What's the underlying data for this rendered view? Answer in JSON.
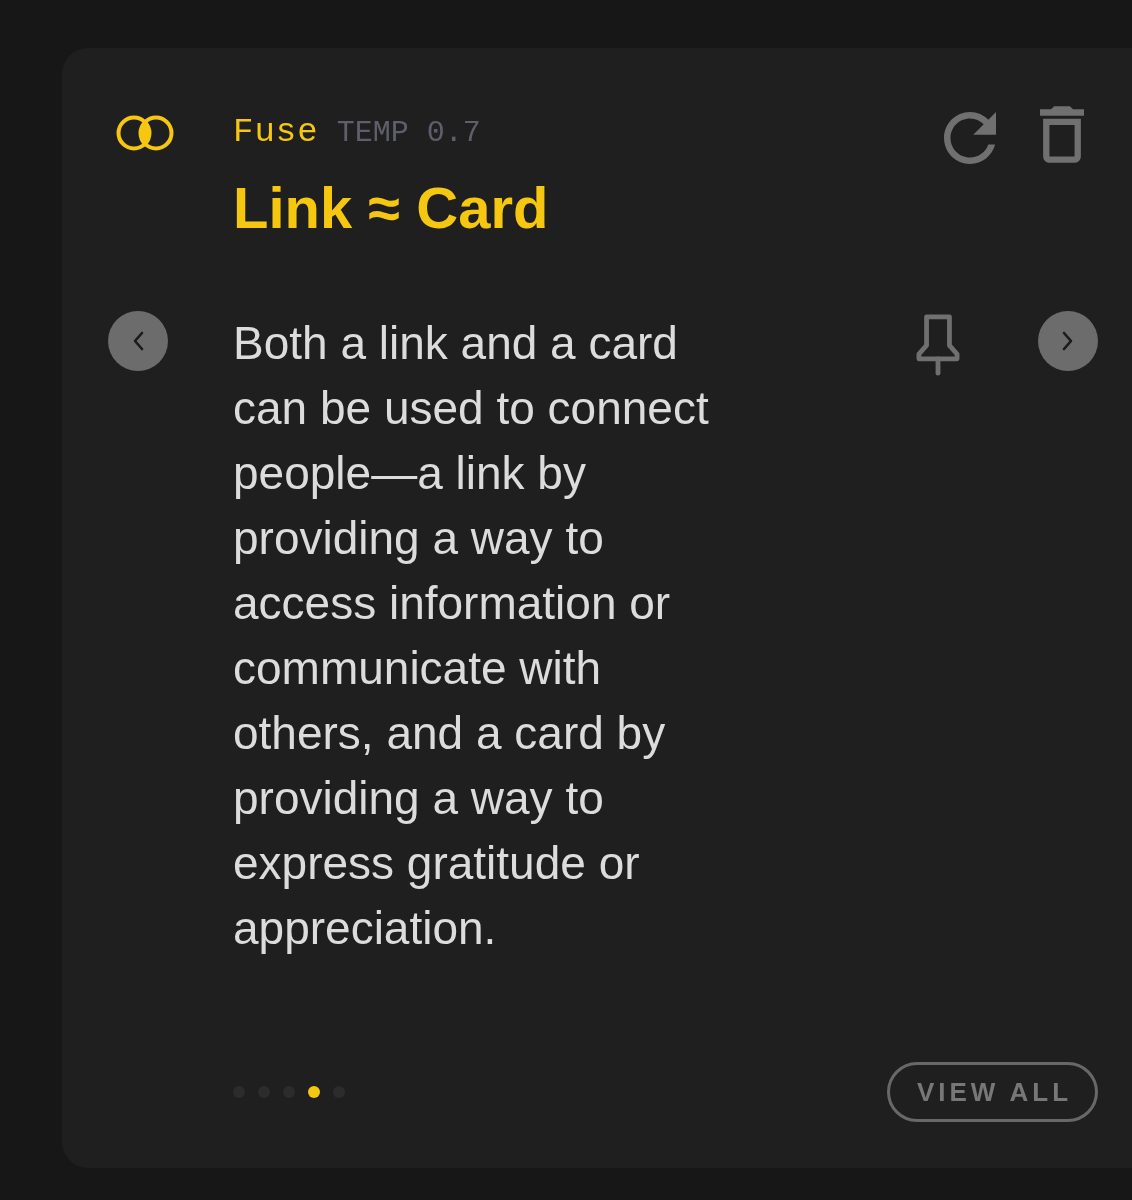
{
  "card": {
    "app_name": "Fuse",
    "temperature": "TEMP 0.7",
    "title": "Link ≈ Card",
    "body": "Both a link and a card can be used to connect people—a link by providing a way to access information or communicate with others, and a card by providing a way to express gratitude or appreciation.",
    "pagination": [
      {
        "selected": false
      },
      {
        "selected": false
      },
      {
        "selected": false
      },
      {
        "selected": true
      },
      {
        "selected": false
      }
    ],
    "view_all": "VIEW ALL"
  }
}
